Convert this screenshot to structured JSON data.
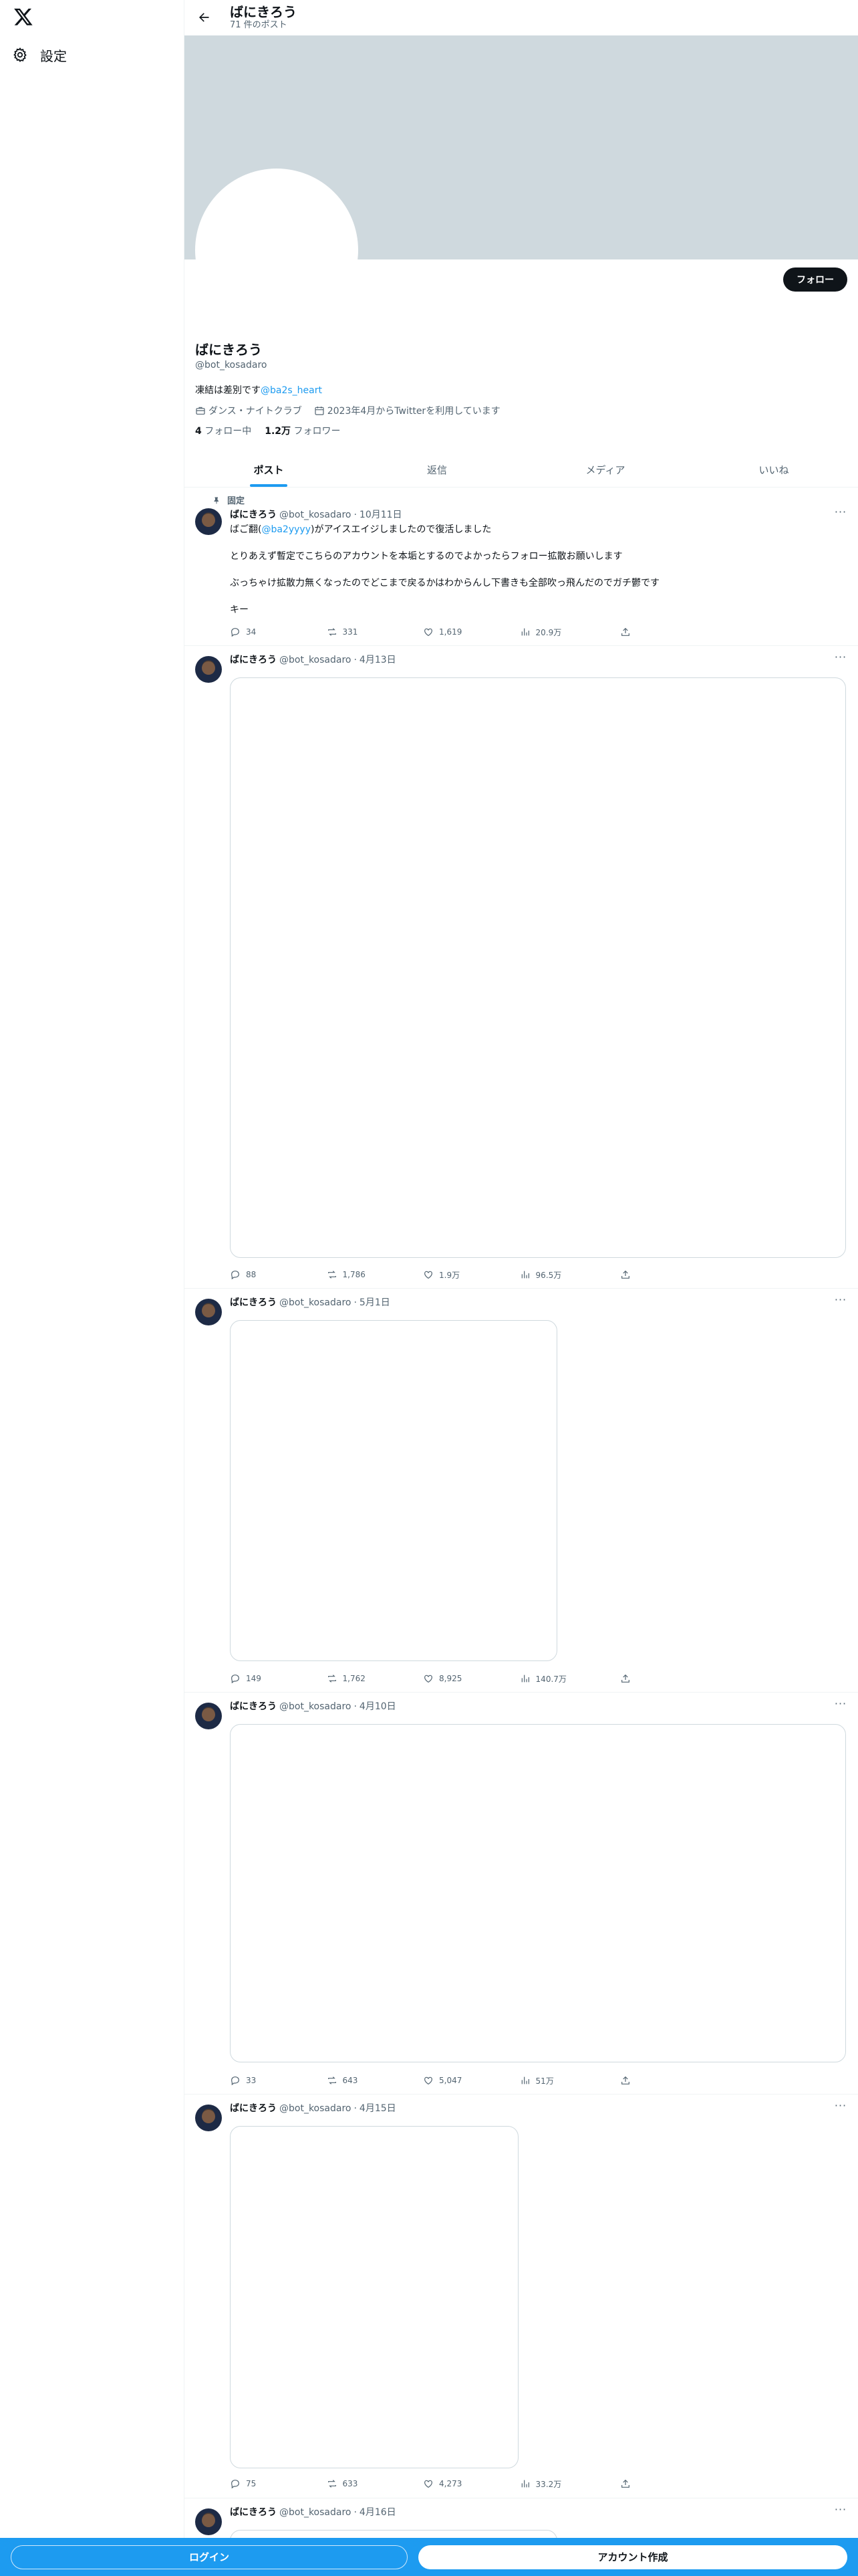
{
  "sidebar": {
    "logo_icon": "x-logo-icon",
    "settings_label": "設定"
  },
  "header": {
    "name": "ばにきろう",
    "post_count": "71 件のポスト"
  },
  "profile": {
    "follow_label": "フォロー",
    "name": "ばにきろう",
    "handle": "@bot_kosadaro",
    "bio_text": "凍結は差別です",
    "bio_link": "@ba2s_heart",
    "category": "ダンス・ナイトクラブ",
    "joined": "2023年4月からTwitterを利用しています",
    "following_count": "4",
    "following_label": "フォロー中",
    "followers_count": "1.2万",
    "followers_label": "フォロワー"
  },
  "tabs": [
    "ポスト",
    "返信",
    "メディア",
    "いいね"
  ],
  "tweets": [
    {
      "pinned_label": "固定",
      "name": "ばにきろう",
      "handle": "@bot_kosadaro",
      "date": "10月11日",
      "line1_prefix": "ばご翻(",
      "line1_link": "@ba2yyyy",
      "line1_suffix": ")がアイスエイジしましたので復活しました",
      "line2": "とりあえず暫定でこちらのアカウントを本垢とするのでよかったらフォロー拡散お願いします",
      "line3": "ぶっちゃけ拡散力無くなったのでどこまで戻るかはわからんし下書きも全部吹っ飛んだのでガチ鬱です",
      "line4": "キー",
      "replies": "34",
      "reposts": "331",
      "likes": "1,619",
      "views": "20.9万"
    },
    {
      "name": "ばにきろう",
      "handle": "@bot_kosadaro",
      "date": "4月13日",
      "replies": "88",
      "reposts": "1,786",
      "likes": "1.9万",
      "views": "96.5万"
    },
    {
      "name": "ばにきろう",
      "handle": "@bot_kosadaro",
      "date": "5月1日",
      "replies": "149",
      "reposts": "1,762",
      "likes": "8,925",
      "views": "140.7万"
    },
    {
      "name": "ばにきろう",
      "handle": "@bot_kosadaro",
      "date": "4月10日",
      "replies": "33",
      "reposts": "643",
      "likes": "5,047",
      "views": "51万"
    },
    {
      "name": "ばにきろう",
      "handle": "@bot_kosadaro",
      "date": "4月15日",
      "replies": "75",
      "reposts": "633",
      "likes": "4,273",
      "views": "33.2万"
    },
    {
      "name": "ばにきろう",
      "handle": "@bot_kosadaro",
      "date": "4月16日"
    }
  ],
  "bottom": {
    "login_label": "ログイン",
    "signup_label": "アカウント作成"
  },
  "colors": {
    "accent": "#1d9bf0",
    "banner": "#cfd9de",
    "text": "#0f1419",
    "muted": "#536471"
  }
}
